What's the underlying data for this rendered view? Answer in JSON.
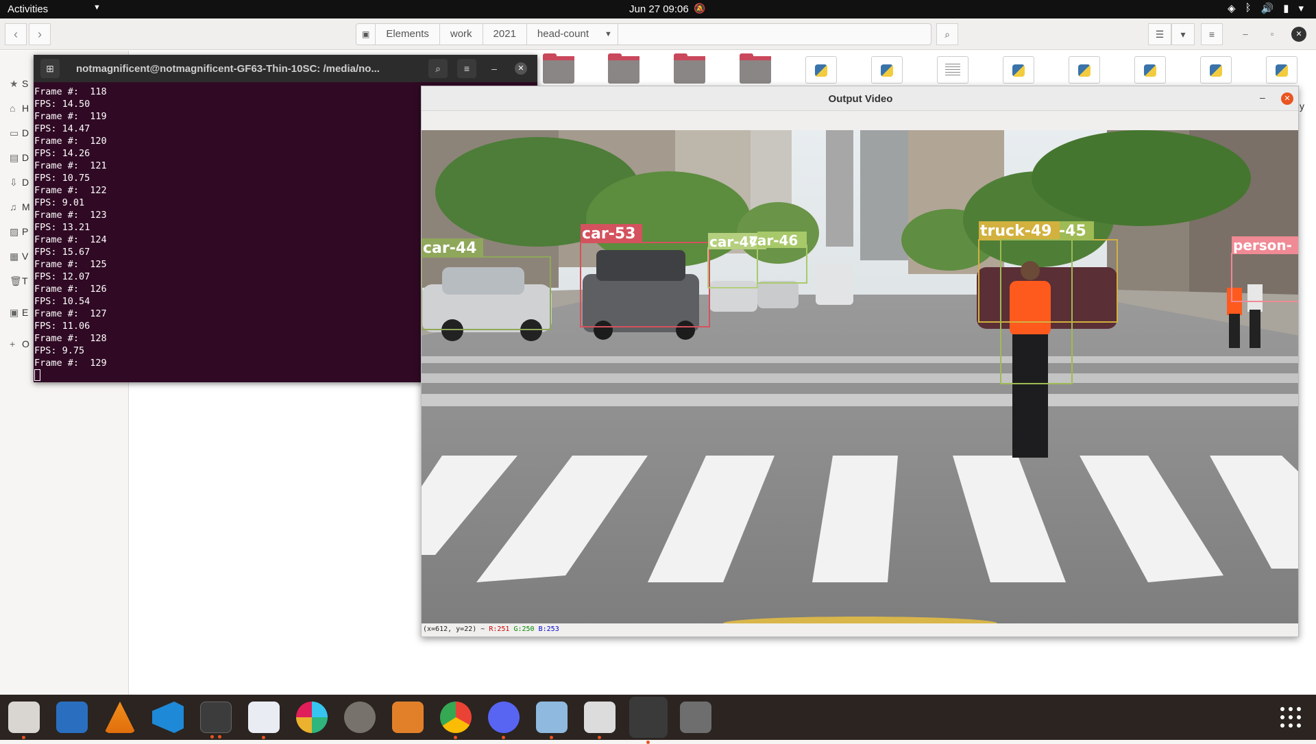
{
  "topbar": {
    "activities": "Activities",
    "clock": "Jun 27  09:06"
  },
  "files": {
    "path": [
      "Elements",
      "work",
      "2021",
      "head-count"
    ],
    "sidebar": [
      "S",
      "H",
      "D",
      "D",
      "D",
      "M",
      "P",
      "V",
      "T",
      "E",
      "O"
    ],
    "side_text": "y"
  },
  "terminal": {
    "title": "notmagnificent@notmagnificent-GF63-Thin-10SC: /media/no...",
    "lines": [
      "Frame #:  118",
      "FPS: 14.50",
      "Frame #:  119",
      "FPS: 14.47",
      "Frame #:  120",
      "FPS: 14.26",
      "Frame #:  121",
      "FPS: 10.75",
      "Frame #:  122",
      "FPS: 9.01",
      "Frame #:  123",
      "FPS: 13.21",
      "Frame #:  124",
      "FPS: 15.67",
      "Frame #:  125",
      "FPS: 12.07",
      "Frame #:  126",
      "FPS: 10.54",
      "Frame #:  127",
      "FPS: 11.06",
      "Frame #:  128",
      "FPS: 9.75",
      "Frame #:  129"
    ]
  },
  "video": {
    "title": "Output Video",
    "detections": [
      {
        "label": "car-44",
        "color": "#8fa75a"
      },
      {
        "label": "car-53",
        "color": "#d4525e"
      },
      {
        "label": "car-47",
        "color": "#b4cf7d"
      },
      {
        "label": "car-46",
        "color": "#a8c96a"
      },
      {
        "label": "truck-49",
        "color": "#d2b13f"
      },
      {
        "label": "-45",
        "color": "#9fbb55"
      },
      {
        "label": "person-",
        "color": "#f08a95"
      }
    ],
    "status": {
      "coords": "(x=612, y=22) ~ ",
      "r": "R:251",
      "g": "G:250",
      "b": "B:253"
    }
  },
  "dock": {
    "apps": [
      "files-icon",
      "writer-icon",
      "vlc-icon",
      "vscode-icon",
      "terminal-icon",
      "text-editor-icon",
      "slack-icon",
      "settings-icon",
      "impress-icon",
      "chrome-icon",
      "discord-icon",
      "package-icon",
      "document-viewer-icon",
      "window-icon",
      "usb-drive-icon"
    ]
  }
}
